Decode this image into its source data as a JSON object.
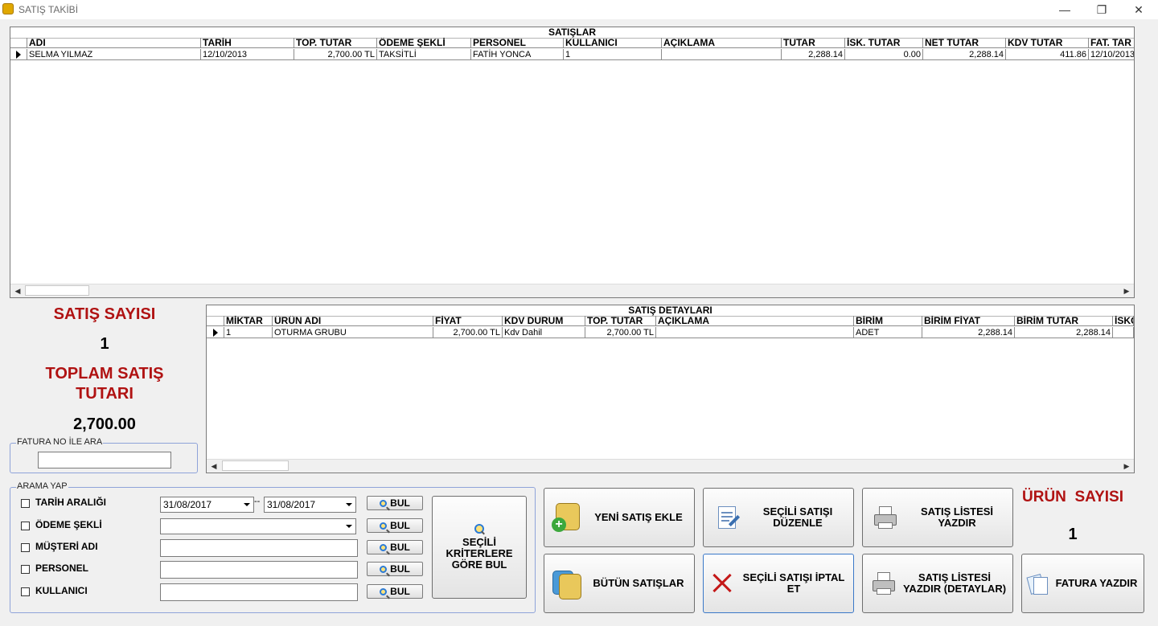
{
  "window": {
    "title": "SATIŞ TAKİBİ",
    "minimize": "—",
    "maximize": "❐",
    "close": "✕"
  },
  "sales_grid": {
    "caption": "SATIŞLAR",
    "columns": [
      "ADI",
      "TARİH",
      "TOP. TUTAR",
      "ÖDEME ŞEKLİ",
      "PERSONEL",
      "KULLANICI",
      "AÇIKLAMA",
      "TUTAR",
      "İSK. TUTAR",
      "NET TUTAR",
      "KDV TUTAR",
      "FAT. TAR"
    ],
    "rows": [
      [
        "SELMA YILMAZ",
        "12/10/2013",
        "2,700.00 TL",
        "TAKSİTLİ",
        "FATİH YONCA",
        "1",
        "",
        "2,288.14",
        "0.00",
        "2,288.14",
        "411.86",
        "12/10/2013"
      ]
    ]
  },
  "details_grid": {
    "caption": "SATIŞ DETAYLARI",
    "columns": [
      "MİKTAR",
      "ÜRÜN ADI",
      "FİYAT",
      "KDV DURUM",
      "TOP. TUTAR",
      "AÇIKLAMA",
      "BİRİM",
      "BİRİM FİYAT",
      "BİRİM TUTAR",
      "İSKO"
    ],
    "rows": [
      [
        "1",
        "OTURMA GRUBU",
        "2,700.00 TL",
        "Kdv Dahil",
        "2,700.00 TL",
        "",
        "ADET",
        "2,288.14",
        "2,288.14",
        ""
      ]
    ]
  },
  "stats": {
    "sales_count_label": "SATIŞ SAYISI",
    "sales_count": "1",
    "total_label_line1": "TOPLAM SATIŞ",
    "total_label_line2": "TUTARI",
    "total_value": "2,700.00",
    "product_count_label": "ÜRÜN  SAYISI",
    "product_count": "1"
  },
  "invoice_search": {
    "label": "FATURA NO İLE ARA",
    "value": ""
  },
  "search": {
    "label": "ARAMA YAP",
    "date_range_label": "TARİH ARALIĞI",
    "date_from": "31/08/2017",
    "date_sep": "--",
    "date_to": "31/08/2017",
    "payment_label": "ÖDEME ŞEKLİ",
    "payment_value": "",
    "customer_label": "MÜŞTERİ ADI",
    "staff_label": "PERSONEL",
    "user_label": "KULLANICI",
    "find_label": "BUL",
    "criteria_button": "SEÇİLİ KRİTERLERE GÖRE BUL"
  },
  "actions": {
    "new_sale": "YENİ SATIŞ EKLE",
    "edit_sale": "SEÇİLİ SATIŞI DÜZENLE",
    "print_list": "SATIŞ LİSTESİ YAZDIR",
    "all_sales": "BÜTÜN SATIŞLAR",
    "cancel_sale": "SEÇİLİ SATIŞI İPTAL ET",
    "print_list_details": "SATIŞ LİSTESİ YAZDIR (DETAYLAR)",
    "print_invoice": "FATURA YAZDIR"
  }
}
